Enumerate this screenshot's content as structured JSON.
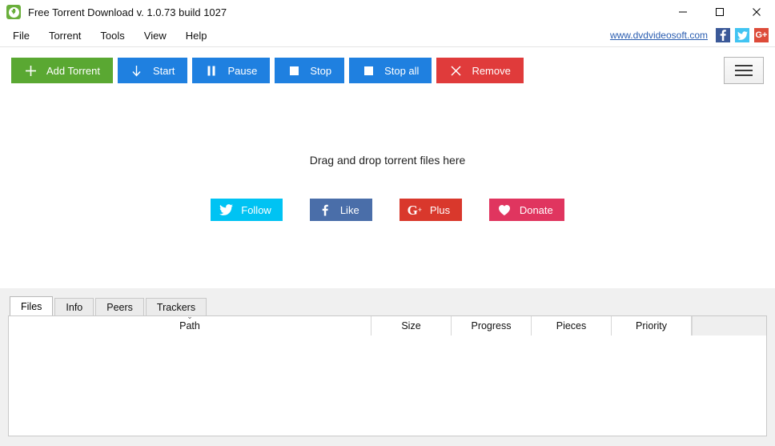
{
  "window": {
    "title": "Free Torrent Download v. 1.0.73 build 1027",
    "app_icon": "download-arrow-icon",
    "minimize_label": "–",
    "maximize_label": "□",
    "close_label": "✕"
  },
  "menubar": {
    "items": [
      {
        "label": "File"
      },
      {
        "label": "Torrent"
      },
      {
        "label": "Tools"
      },
      {
        "label": "View"
      },
      {
        "label": "Help"
      }
    ]
  },
  "brand": {
    "site_url": "www.dvdvideosoft.com",
    "facebook_glyph": "f",
    "twitter_glyph": "❦",
    "googleplus_glyph": "G+",
    "facebook_color": "#3b5998",
    "twitter_color": "#41c4f2",
    "googleplus_color": "#dd4b39"
  },
  "toolbar": {
    "add_torrent_label": "Add Torrent",
    "start_label": "Start",
    "pause_label": "Pause",
    "stop_label": "Stop",
    "stop_all_label": "Stop all",
    "remove_label": "Remove",
    "menu_label": "",
    "green": "#5aa832",
    "blue": "#1f80e0",
    "red": "#e03b3b"
  },
  "main": {
    "drop_hint": "Drag and drop torrent files here",
    "social_buttons": [
      {
        "label": "Follow",
        "icon": "twitter-icon",
        "color": "#00c3f3"
      },
      {
        "label": "Like",
        "icon": "facebook-icon",
        "color": "#4a6ea9"
      },
      {
        "label": "Plus",
        "icon": "googleplus-icon",
        "color": "#d9382c"
      },
      {
        "label": "Donate",
        "icon": "heart-icon",
        "color": "#e0355f"
      }
    ]
  },
  "panel": {
    "tabs": [
      {
        "label": "Files",
        "active": true
      },
      {
        "label": "Info",
        "active": false
      },
      {
        "label": "Peers",
        "active": false
      },
      {
        "label": "Trackers",
        "active": false
      }
    ],
    "columns": [
      {
        "label": "Path",
        "sorted": true,
        "sort_glyph": "⌄"
      },
      {
        "label": "Size",
        "sorted": false
      },
      {
        "label": "Progress",
        "sorted": false
      },
      {
        "label": "Pieces",
        "sorted": false
      },
      {
        "label": "Priority",
        "sorted": false
      }
    ],
    "rows": []
  }
}
